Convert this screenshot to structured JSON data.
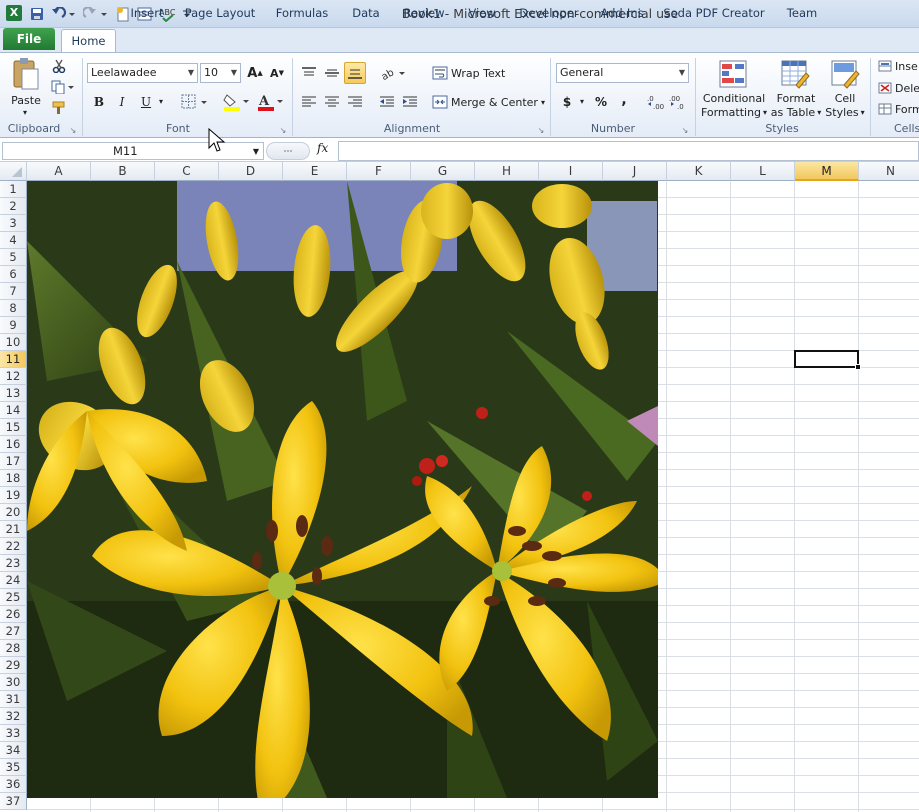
{
  "window": {
    "title": "Book1  -  Microsoft Excel non-commercial use",
    "logo": "X"
  },
  "tabs": [
    {
      "label": "File"
    },
    {
      "label": "Home"
    },
    {
      "label": "Insert"
    },
    {
      "label": "Page Layout"
    },
    {
      "label": "Formulas"
    },
    {
      "label": "Data"
    },
    {
      "label": "Review"
    },
    {
      "label": "View"
    },
    {
      "label": "Developer"
    },
    {
      "label": "Add-Ins"
    },
    {
      "label": "Soda PDF Creator"
    },
    {
      "label": "Team"
    }
  ],
  "ribbon": {
    "clipboard": {
      "label": "Clipboard",
      "paste": "Paste"
    },
    "font": {
      "label": "Font",
      "name": "Leelawadee",
      "size": "10",
      "bold": "B",
      "italic": "I",
      "underline": "U"
    },
    "alignment": {
      "label": "Alignment",
      "wrap": "Wrap Text",
      "merge": "Merge & Center"
    },
    "number": {
      "label": "Number",
      "format": "General",
      "currency": "$",
      "percent": "%",
      "comma": ","
    },
    "styles": {
      "label": "Styles",
      "conditional_1": "Conditional",
      "conditional_2": "Formatting",
      "format_table_1": "Format",
      "format_table_2": "as Table",
      "cell_styles_1": "Cell",
      "cell_styles_2": "Styles"
    },
    "cells": {
      "label": "Cells",
      "insert": "Inse",
      "delete": "Dele",
      "format": "Form"
    }
  },
  "formula_bar": {
    "name_box": "M11",
    "fx": "fx",
    "value": ""
  },
  "columns": [
    "A",
    "B",
    "C",
    "D",
    "E",
    "F",
    "G",
    "H",
    "I",
    "J",
    "K",
    "L",
    "M",
    "N"
  ],
  "rows": [
    "1",
    "2",
    "3",
    "4",
    "5",
    "6",
    "7",
    "8",
    "9",
    "10",
    "11",
    "12",
    "13",
    "14",
    "15",
    "16",
    "17",
    "18",
    "19",
    "20",
    "21",
    "22",
    "23",
    "24",
    "25",
    "26",
    "27",
    "28",
    "29",
    "30",
    "31",
    "32",
    "33",
    "34",
    "35",
    "36",
    "37"
  ],
  "selection": {
    "column": "M",
    "row": "11"
  },
  "colors": {
    "accent": "#217a33",
    "selection": "#f3c75a",
    "ribbon": "#dfe9f5"
  }
}
